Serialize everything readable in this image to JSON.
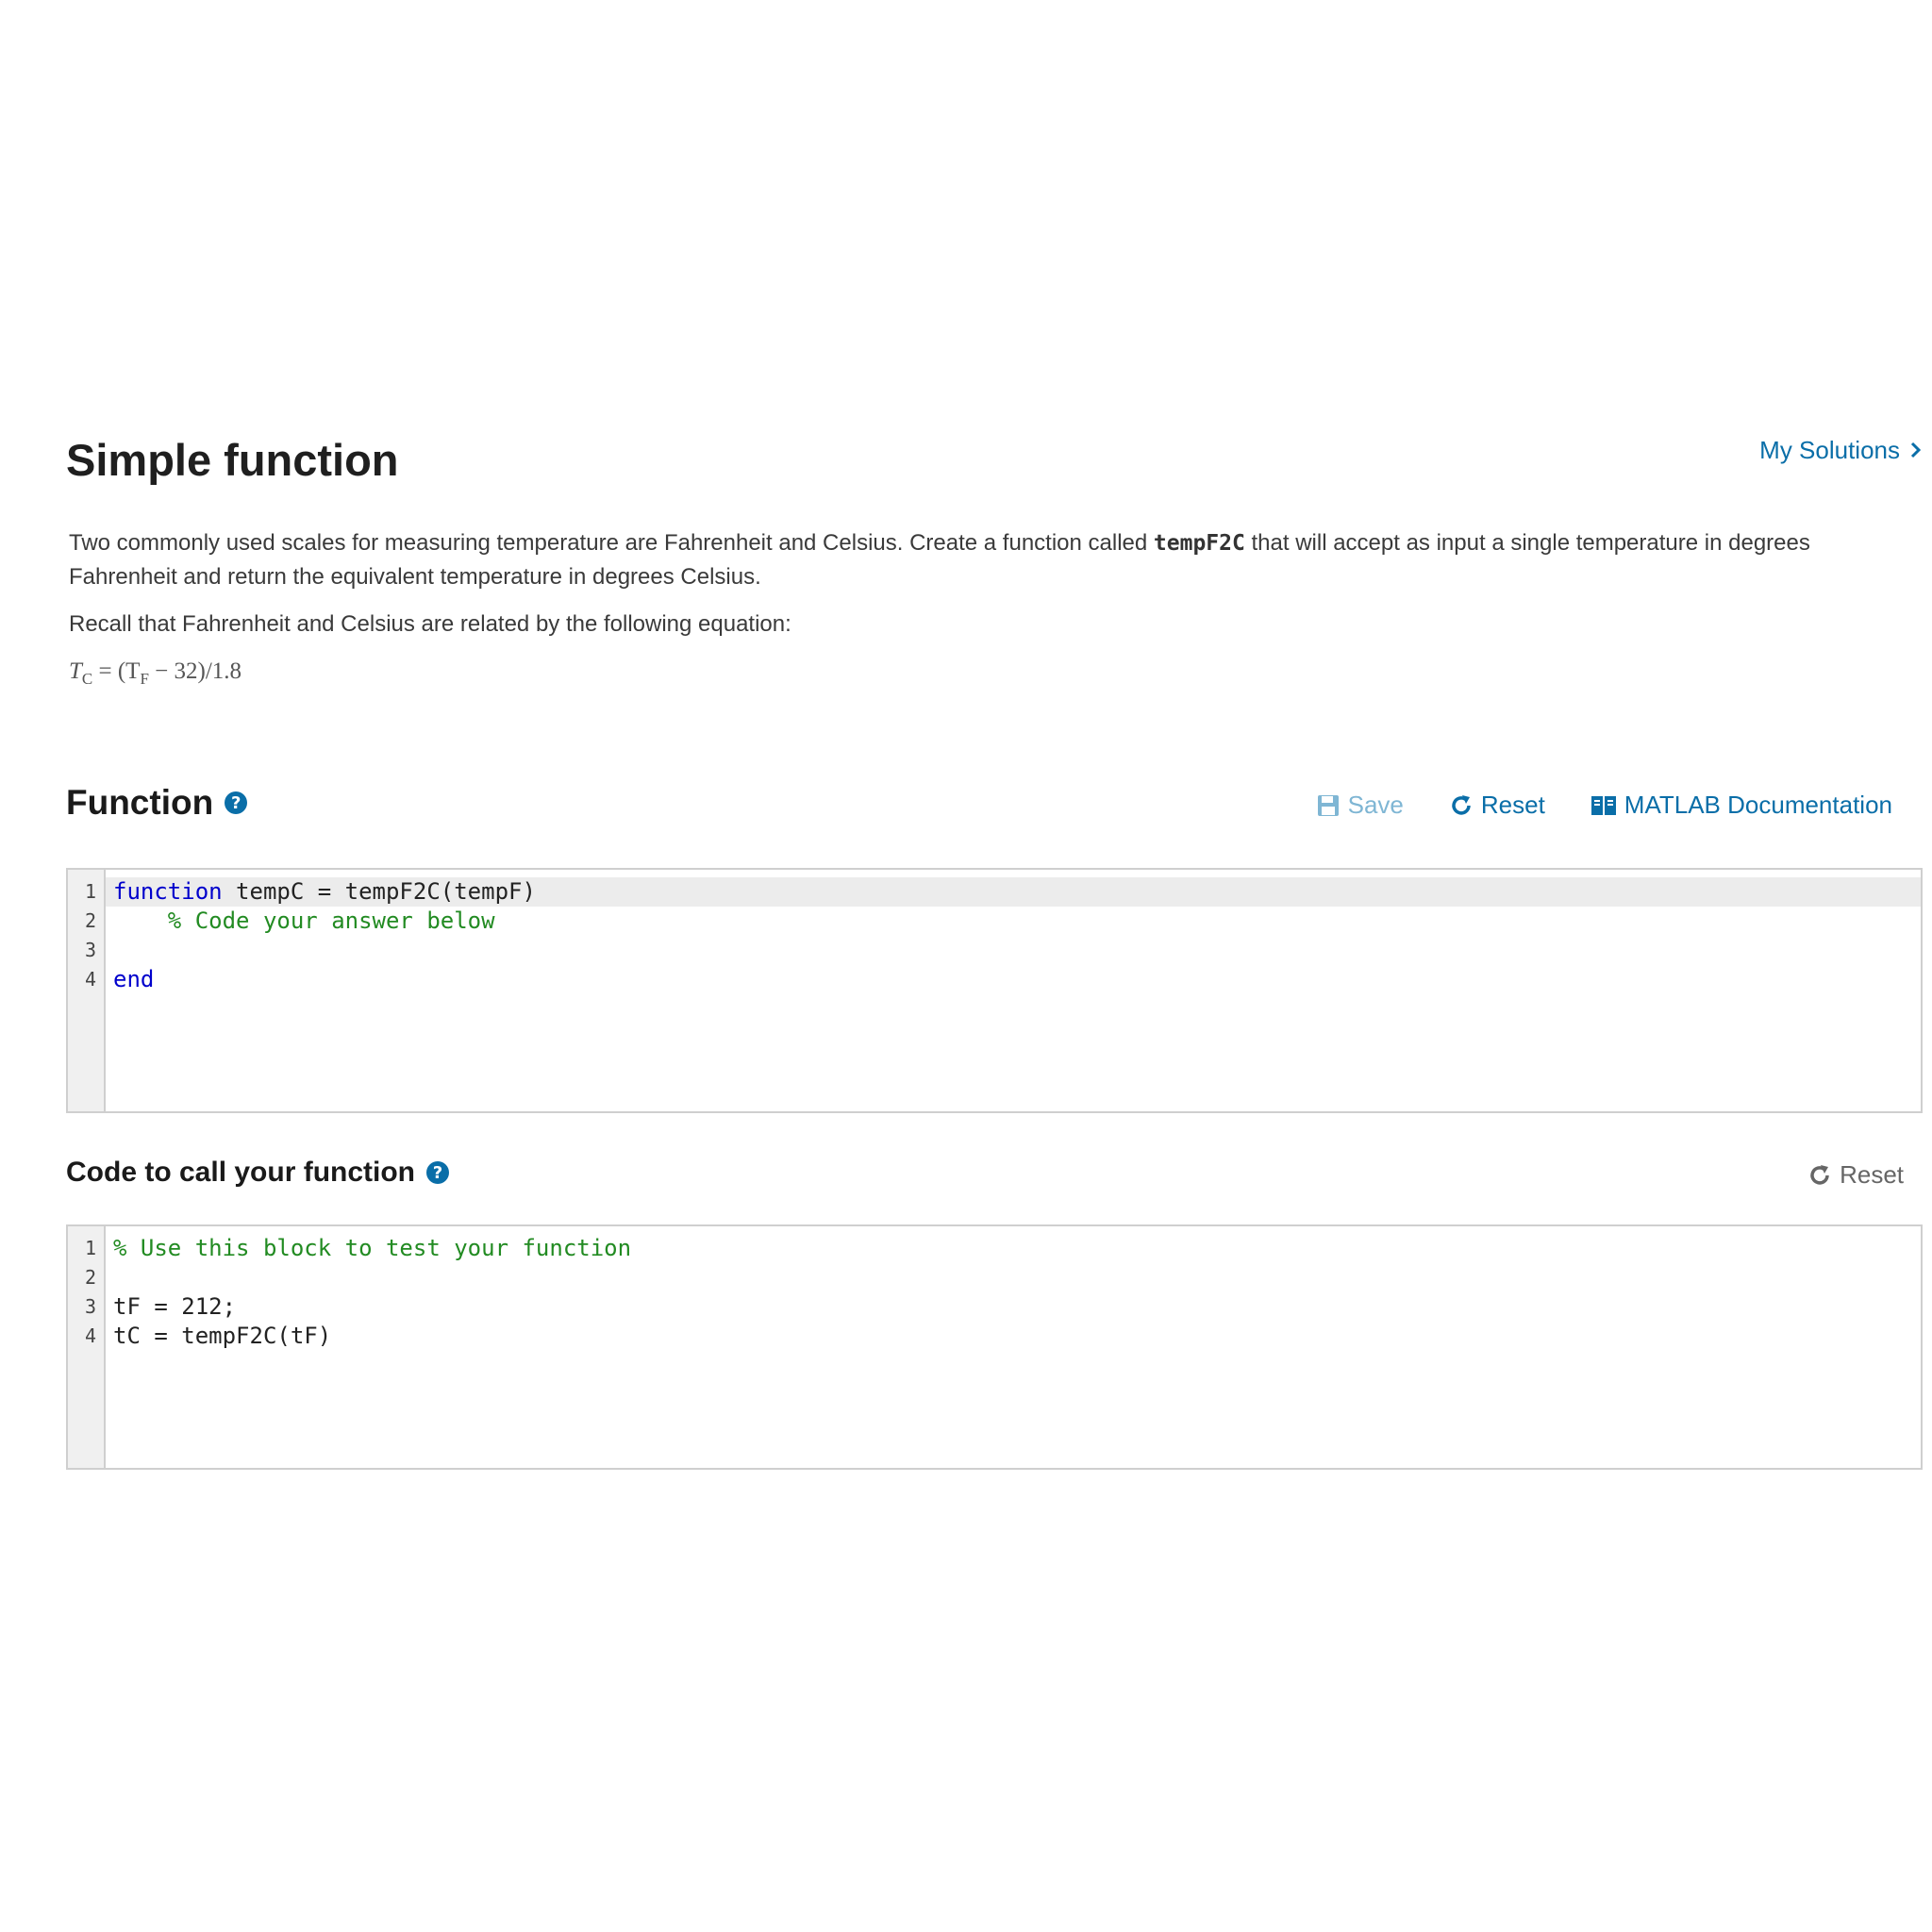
{
  "header": {
    "title": "Simple function",
    "my_solutions_label": "My Solutions"
  },
  "description": {
    "para1_before": "Two commonly used scales for measuring temperature are Fahrenheit and Celsius. Create a function called ",
    "para1_code": "tempF2C",
    "para1_after": " that will accept as input a single temperature in degrees Fahrenheit and return the equivalent temperature in degrees Celsius.",
    "para2": "Recall that Fahrenheit and Celsius are related by the following equation:",
    "equation_lhs": "T",
    "equation_lhs_sub": "C",
    "equation_mid": " = (T",
    "equation_mid_sub": "F",
    "equation_rhs": " − 32)/1.8"
  },
  "function_section": {
    "title": "Function",
    "help_glyph": "?",
    "toolbar": {
      "save_label": "Save",
      "reset_label": "Reset",
      "docs_label": "MATLAB Documentation"
    },
    "line_numbers": [
      "1",
      "2",
      "3",
      "4"
    ],
    "lines": [
      {
        "kw": "function",
        "text": " tempC = tempF2C(tempF)"
      },
      {
        "cm": "    % Code your answer below"
      },
      {
        "text": ""
      },
      {
        "kw": "end"
      }
    ]
  },
  "call_section": {
    "title": "Code to call your function",
    "help_glyph": "?",
    "reset_label": "Reset",
    "line_numbers": [
      "1",
      "2",
      "3",
      "4"
    ],
    "lines": [
      {
        "cm": "% Use this block to test your function"
      },
      {
        "text": ""
      },
      {
        "text": "tF = 212;"
      },
      {
        "text": "tC = tempF2C(tF)"
      }
    ]
  },
  "colors": {
    "link": "#0a6ea8",
    "keyword": "#0000cc",
    "comment": "#228b22"
  },
  "icons": [
    "chevron-right-icon",
    "help-icon",
    "save-icon",
    "reset-icon",
    "book-icon"
  ]
}
